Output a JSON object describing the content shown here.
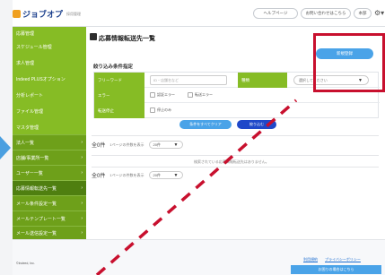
{
  "topbar": {
    "app_name": "ジョブオプ",
    "app_sub": "採用管理",
    "help_label": "ヘルプページ",
    "contact_label": "お問い合わせはこちら",
    "user_label": "本部",
    "gear_icon": "gear-icon"
  },
  "sidebar": {
    "items": [
      {
        "label": "応募管理",
        "expanded": false
      },
      {
        "label": "スケジュール管理",
        "expanded": false
      },
      {
        "label": "求人管理",
        "expanded": false
      },
      {
        "label": "Indeed PLUSオプション",
        "expanded": false
      },
      {
        "label": "分析レポート",
        "expanded": false
      },
      {
        "label": "ファイル管理",
        "expanded": false
      },
      {
        "label": "マスタ管理",
        "expanded": true
      }
    ],
    "subitems": [
      {
        "label": "法人一覧"
      },
      {
        "label": "店舗/事業所一覧"
      },
      {
        "label": "ユーザー一覧"
      },
      {
        "label": "応募情報転送先一覧",
        "active": true
      },
      {
        "label": "メール条件設定一覧"
      },
      {
        "label": "メールテンプレート一覧"
      },
      {
        "label": "メール送信設定一覧"
      }
    ]
  },
  "main": {
    "page_title": "応募情報転送先一覧",
    "new_button": "新規登録",
    "filter_title": "絞り込み条件指定",
    "filter": {
      "freeword_label": "フリーワード",
      "freeword_placeholder": "ID・店舗名など",
      "type_label": "種類",
      "type_value": "選択してください",
      "error_label": "エラー",
      "error_opt1": "認証エラー",
      "error_opt2": "転送エラー",
      "stop_label": "転送停止",
      "stop_opt1": "停止のみ"
    },
    "clear_button": "条件をすべてクリア",
    "search_button": "絞り込む",
    "count_top": "全0件",
    "per_page_label": "1ページの件数を表示",
    "per_page_value": "20件",
    "empty_message": "検索されている応募情報転送先はありません。",
    "count_bottom": "全0件"
  },
  "footer": {
    "copyright": "©Indeed, Inc.",
    "link_terms": "利用規約",
    "link_privacy": "プライバシーポリシー",
    "faq_button": "お困りの場合はこちら"
  },
  "colors": {
    "sidebar_green": "#86bc25",
    "accent_blue": "#4aa3e8",
    "search_blue": "#1f48c9",
    "highlight_red": "#c8102e"
  }
}
